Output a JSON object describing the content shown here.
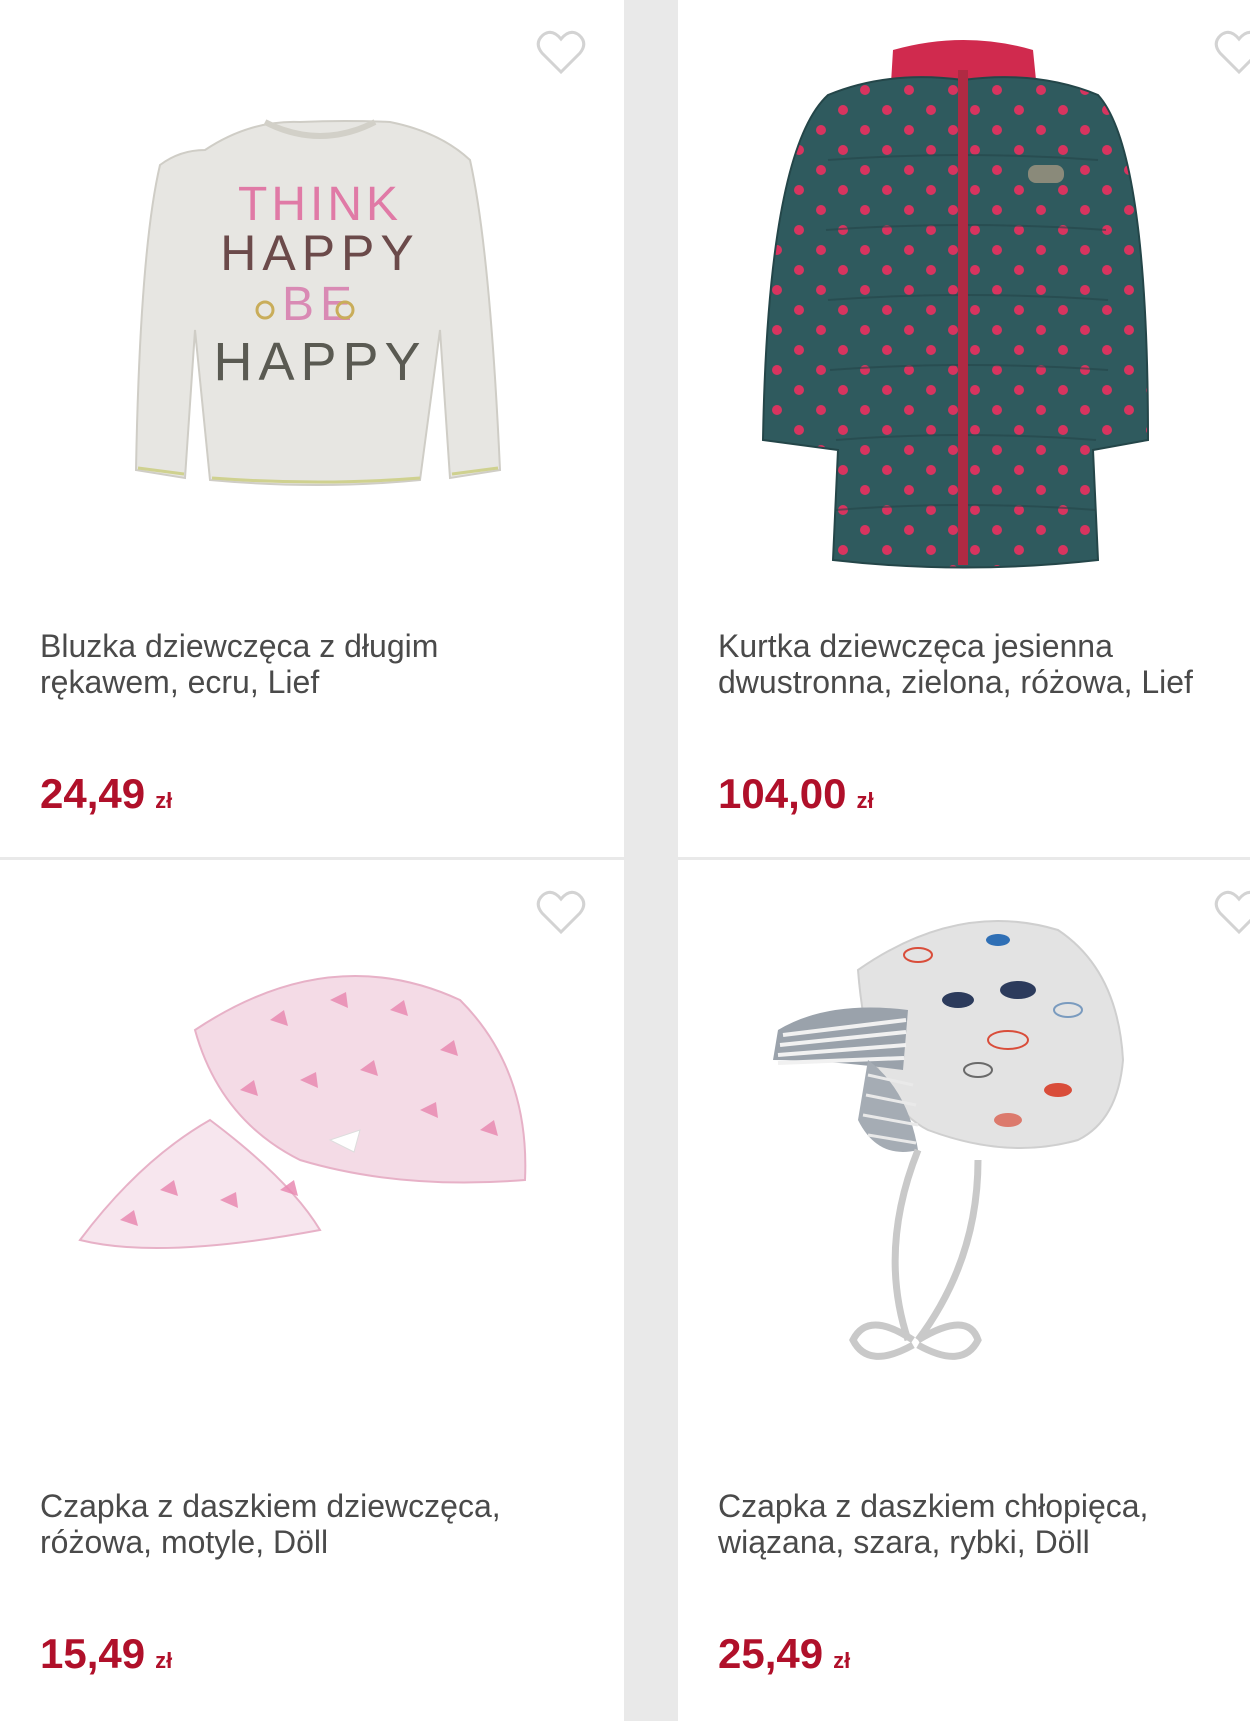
{
  "colors": {
    "price": "#b0102a",
    "title": "#4a4a4a",
    "heart_outline": "#d3d3d3",
    "background": "#e9e9e9",
    "card": "#ffffff"
  },
  "products": [
    {
      "title": "Bluzka dziewczęca z długim\nrękawem, ecru, Lief",
      "price": "24,49",
      "currency": "zł",
      "image_icon": "long-sleeve-shirt-image",
      "shirt_text": [
        "THINK",
        "HAPPY",
        "BE",
        "HAPPY"
      ]
    },
    {
      "title": "Kurtka dziewczęca jesienna\ndwustronna, zielona, różowa, Lief",
      "price": "104,00",
      "currency": "zł",
      "image_icon": "puffer-jacket-image"
    },
    {
      "title": "Czapka z daszkiem dziewczęca,\nróżowa, motyle, Döll",
      "price": "15,49",
      "currency": "zł",
      "image_icon": "butterfly-cap-image"
    },
    {
      "title": "Czapka z daszkiem chłopięca,\nwiązana, szara, rybki, Döll",
      "price": "25,49",
      "currency": "zł",
      "image_icon": "fish-hat-image"
    }
  ]
}
